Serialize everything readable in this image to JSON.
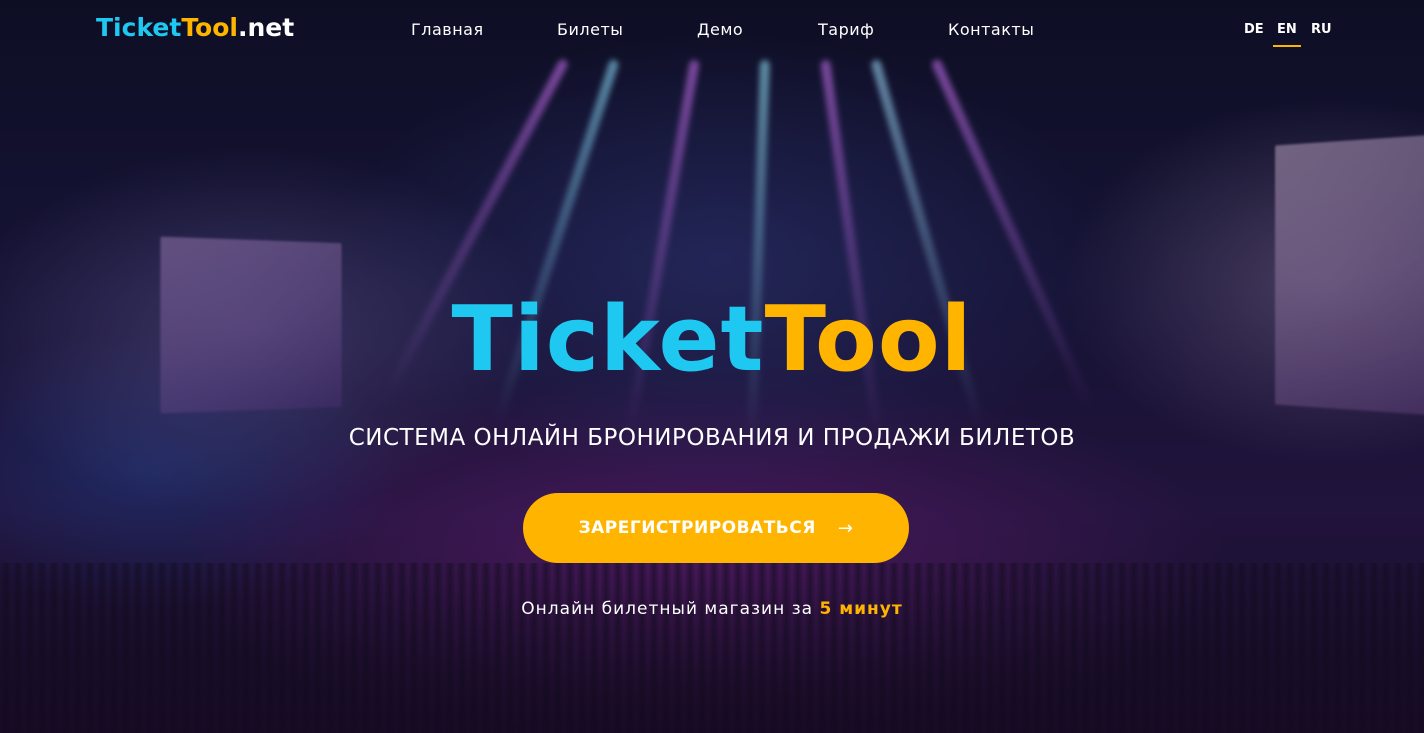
{
  "header": {
    "logo": {
      "part1": "Ticket",
      "part2": "Tool",
      "part3": ".net"
    },
    "nav": [
      {
        "label": "Главная"
      },
      {
        "label": "Билеты"
      },
      {
        "label": "Демо"
      },
      {
        "label": "Тариф"
      },
      {
        "label": "Контакты"
      }
    ],
    "languages": [
      {
        "code": "DE",
        "active": false
      },
      {
        "code": "EN",
        "active": true
      },
      {
        "code": "RU",
        "active": false
      }
    ]
  },
  "hero": {
    "brand": {
      "part1": "Ticket",
      "part2": "Tool"
    },
    "tagline": "СИСТЕМА ОНЛАЙН БРОНИРОВАНИЯ И ПРОДАЖИ БИЛЕТОВ",
    "cta": {
      "label": "ЗАРЕГИСТРИРОВАТЬСЯ",
      "icon": "arrow-right-icon",
      "arrow": "→"
    },
    "subline": {
      "text": "Онлайн билетный магазин за ",
      "highlight": "5 минут"
    }
  },
  "colors": {
    "accent_blue": "#1ec8f0",
    "accent_orange": "#ffb400",
    "text": "#ffffff"
  }
}
